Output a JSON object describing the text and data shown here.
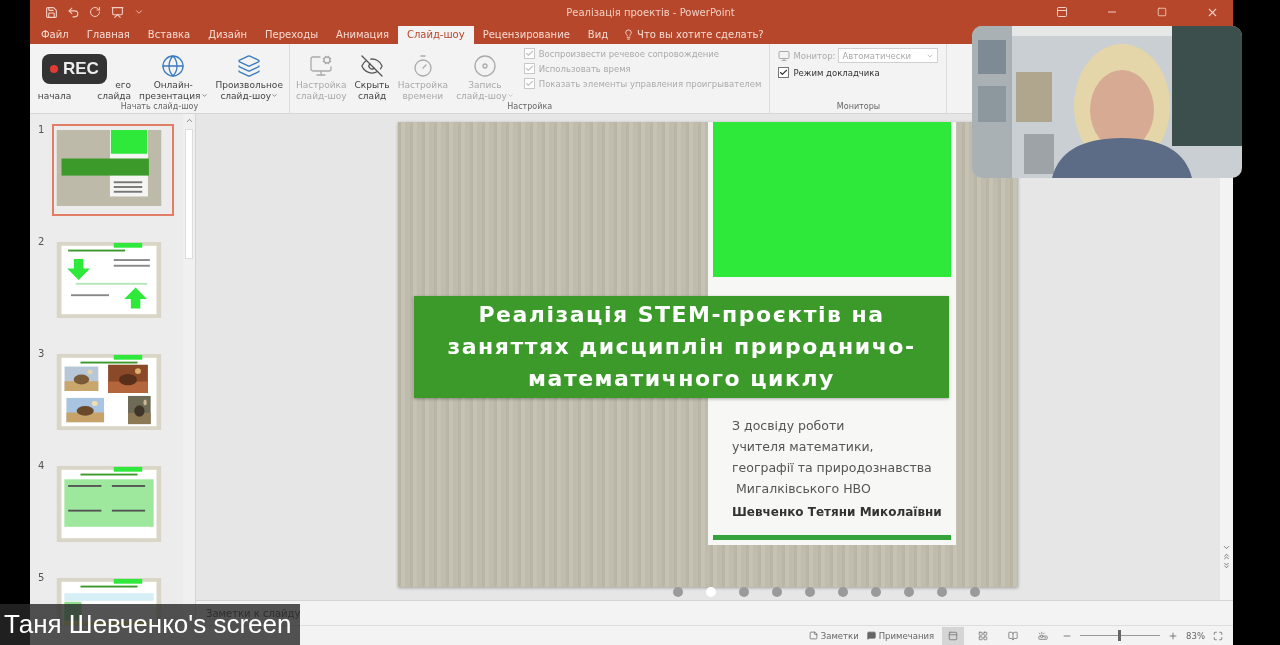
{
  "title_bar": {
    "title": "Реалізація проектів - PowerPoint"
  },
  "ribbon_tabs": [
    {
      "label": "Файл",
      "selected": false
    },
    {
      "label": "Главная",
      "selected": false
    },
    {
      "label": "Вставка",
      "selected": false
    },
    {
      "label": "Дизайн",
      "selected": false
    },
    {
      "label": "Переходы",
      "selected": false
    },
    {
      "label": "Анимация",
      "selected": false
    },
    {
      "label": "Слайд-шоу",
      "selected": true
    },
    {
      "label": "Рецензирование",
      "selected": false
    },
    {
      "label": "Вид",
      "selected": false
    }
  ],
  "tell_me": {
    "label": "Что вы хотите сделать?"
  },
  "ribbon_groups": [
    {
      "label": "Начать слайд-шоу",
      "buttons": [
        {
          "kind": "start",
          "lines": [
            "начала"
          ],
          "disabled": false,
          "dropdown": false
        },
        {
          "kind": "current",
          "lines": [
            "его",
            "слайда"
          ],
          "disabled": false,
          "dropdown": false
        },
        {
          "kind": "online",
          "lines": [
            "Онлайн-",
            "презентация"
          ],
          "disabled": false,
          "dropdown": true
        },
        {
          "kind": "custom",
          "lines": [
            "Произвольное",
            "слайд-шоу"
          ],
          "disabled": false,
          "dropdown": true
        }
      ]
    },
    {
      "label": "Настройка",
      "buttons": [
        {
          "kind": "setup",
          "lines": [
            "Настройка",
            "слайд-шоу"
          ],
          "disabled": true,
          "dropdown": false
        },
        {
          "kind": "hide",
          "lines": [
            "Скрыть",
            "слайд"
          ],
          "disabled": false,
          "dropdown": false
        },
        {
          "kind": "timing",
          "lines": [
            "Настройка",
            "времени"
          ],
          "disabled": true,
          "dropdown": false
        },
        {
          "kind": "record",
          "lines": [
            "Запись",
            "слайд-шоу"
          ],
          "disabled": true,
          "dropdown": true
        }
      ],
      "options": [
        {
          "label": "Воспроизвести речевое сопровождение",
          "checked": true,
          "disabled": true
        },
        {
          "label": "Использовать время",
          "checked": true,
          "disabled": true
        },
        {
          "label": "Показать элементы управления проигрывателем",
          "checked": true,
          "disabled": true
        }
      ]
    },
    {
      "label": "Мониторы",
      "monitor": {
        "label": "Монитор:",
        "value": "Автоматически",
        "disabled": true
      },
      "options": [
        {
          "label": "Режим докладчика",
          "checked": true,
          "disabled": false
        }
      ]
    }
  ],
  "thumbnails": [
    {
      "number": "1",
      "kind": "title",
      "selected": true
    },
    {
      "number": "2",
      "kind": "arrows",
      "selected": false
    },
    {
      "number": "3",
      "kind": "photos",
      "selected": false
    },
    {
      "number": "4",
      "kind": "table",
      "selected": false
    },
    {
      "number": "5",
      "kind": "plan",
      "selected": false
    }
  ],
  "slide": {
    "title_lines": [
      "Реалізація STEM-проєктів на",
      "заняттях дисциплін природничо-",
      "математичного циклу"
    ],
    "subtitle_lines": [
      "З досвіду роботи",
      "учителя математики,",
      "географії та природознавства",
      "Мигалківського НВО"
    ],
    "author": "Шевченко Тетяни Миколаївни"
  },
  "share_dots": [
    {
      "selected": false
    },
    {
      "selected": true
    },
    {
      "selected": false
    },
    {
      "selected": false
    },
    {
      "selected": false
    },
    {
      "selected": false
    },
    {
      "selected": false
    },
    {
      "selected": false
    },
    {
      "selected": false
    },
    {
      "selected": false
    }
  ],
  "notes_bar": {
    "placeholder": "Заметки к слайду"
  },
  "status_bar": {
    "notes": "Заметки",
    "comments": "Примечания",
    "views": [
      {
        "selected": true
      },
      {
        "selected": false
      },
      {
        "selected": false
      },
      {
        "selected": false
      }
    ],
    "zoom": {
      "level": 0.48,
      "reading": "83%"
    }
  },
  "overlay": {
    "rec": "REC",
    "screen_label": "Таня Шевченко's screen"
  }
}
